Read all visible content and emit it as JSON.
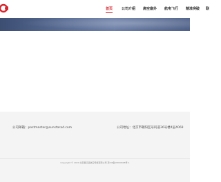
{
  "nav": {
    "items": [
      {
        "label": "首页",
        "active": true
      },
      {
        "label": "公司介绍",
        "active": false
      },
      {
        "label": "高空塞外",
        "active": false
      },
      {
        "label": "航电飞行",
        "active": false
      },
      {
        "label": "精准突破",
        "active": false
      },
      {
        "label": "联",
        "active": false
      }
    ]
  },
  "logo": {
    "icon": "brand-logo-icon",
    "color": "#d6262d"
  },
  "accent_color": "#d6262d",
  "footer": {
    "email": "公司邮箱：postmaster@sunstarad.com",
    "address": "公司地址：北京市朝阳区号码道36号楼4层4069",
    "copyright": "Copyright © 2024 北京星汉道航空传媒有限公司 京ICP备18000698号-1"
  }
}
